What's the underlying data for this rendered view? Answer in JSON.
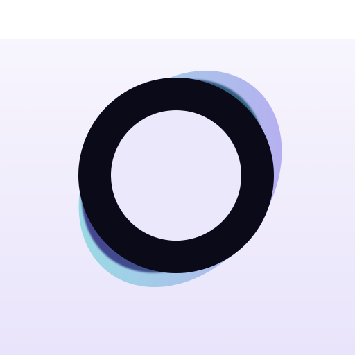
{
  "app_icon": {
    "icon": "ring-logo-icon",
    "colors": {
      "background_top": "#f7f5fd",
      "background_bottom": "#e9e4fb",
      "glow_cyan": "#8fe3e0",
      "glow_violet": "#b9a3f2",
      "shadow_teal": "#2c6f79",
      "shadow_indigo": "#4a3b96",
      "ring": "#0b0a18",
      "ring_hole": "#ece8fb"
    }
  }
}
